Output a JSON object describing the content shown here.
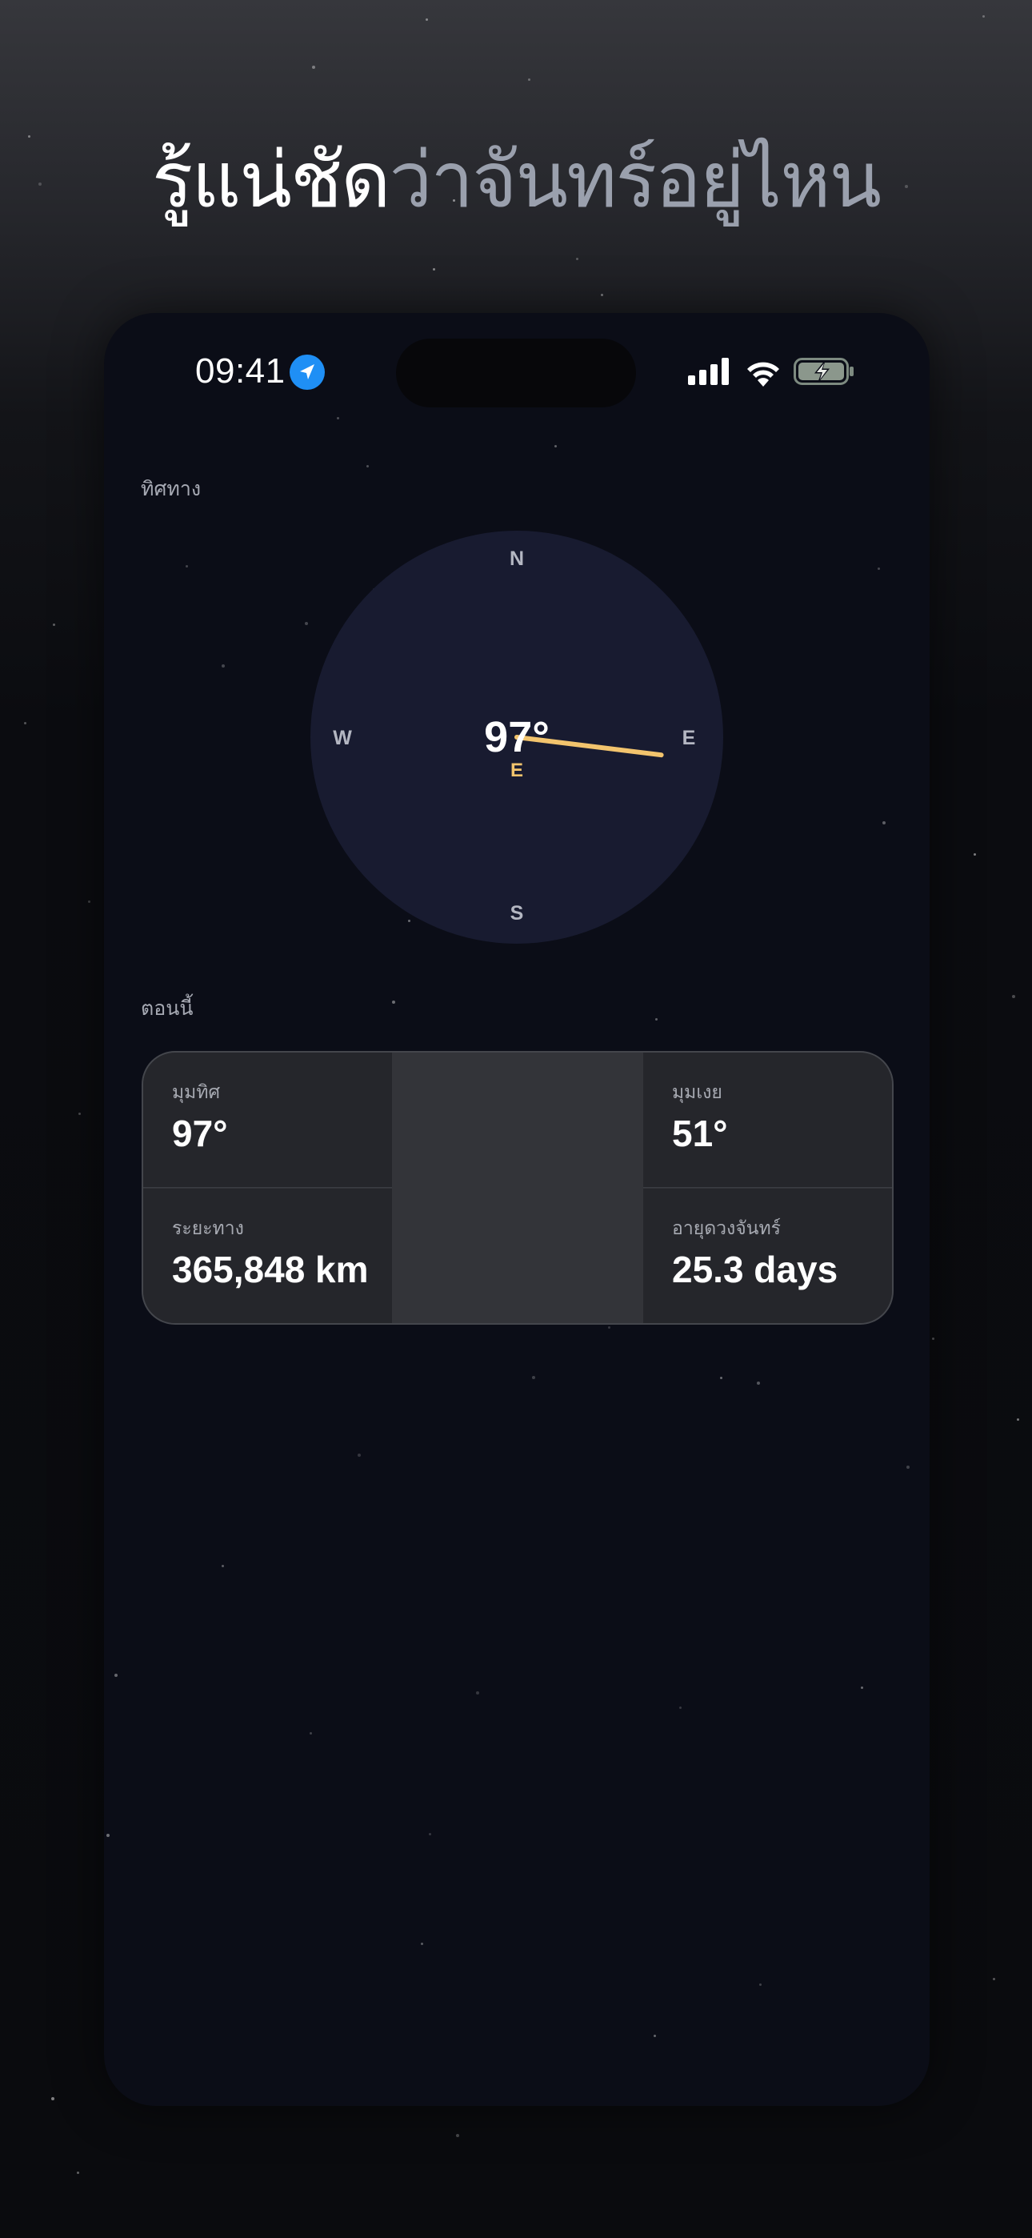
{
  "headline": {
    "bright_part": "รู้แน่ชัด",
    "dim_part": "ว่าจันทร์อยู่ไหน"
  },
  "status_bar": {
    "time": "09:41",
    "location_icon": "location-arrow-icon",
    "signal_icon": "cellular-signal-icon",
    "wifi_icon": "wifi-icon",
    "battery_icon": "battery-charging-icon"
  },
  "direction_section": {
    "label": "ทิศทาง",
    "compass": {
      "heading_text": "97°",
      "heading_cardinal": "E",
      "north": "N",
      "east": "E",
      "south": "S",
      "west": "W",
      "heading_degrees": 97
    }
  },
  "now_section": {
    "label": "ตอนนี้",
    "stats": [
      {
        "label": "มุมทิศ",
        "value": "97°"
      },
      {
        "label": "มุมเงย",
        "value": "51°"
      },
      {
        "label": "ระยะทาง",
        "value": "365,848 km"
      },
      {
        "label": "อายุดวงจันทร์",
        "value": "25.3 days"
      }
    ]
  },
  "colors": {
    "needle": "#f2c46d",
    "compass_face": "#181b30",
    "cardinal_heading": "#f2c46d",
    "location_badge": "#1f8ff5"
  }
}
